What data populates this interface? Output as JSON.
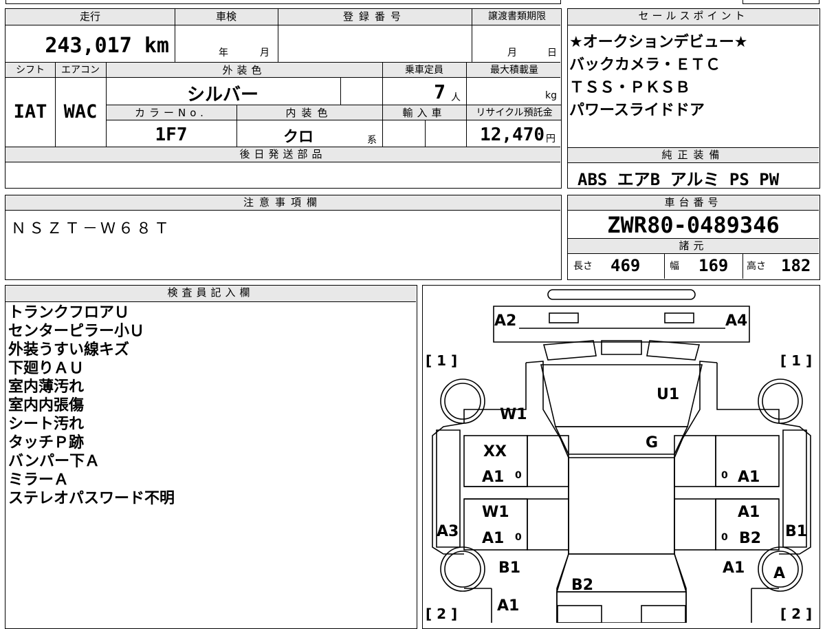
{
  "sheet": {
    "top_labels": {
      "mileage": "走行",
      "shaken": "車検",
      "reg_number": "登録番号",
      "transfer_deadline": "譲渡書類期限",
      "sales_points": "セールスポイント",
      "shift": "シフト",
      "aircon": "エアコン",
      "exterior_color": "外装色",
      "capacity": "乗車定員",
      "max_load": "最大積載量",
      "color_no": "カラーNo.",
      "interior_color": "内装色",
      "import": "輸入車",
      "recycle": "リサイクル預託金",
      "later_parts": "後日発送部品",
      "genuine_equipment": "純正装備",
      "notes": "注意事項欄",
      "chassis_number": "車台番号",
      "specs": "諸元",
      "inspector": "検査員記入欄"
    },
    "mileage_value": "243,017",
    "mileage_unit": "km",
    "shaken_year": "年",
    "shaken_month": "月",
    "transfer_month": "月",
    "transfer_day": "日",
    "shift_value": "IAT",
    "aircon_value": "WAC",
    "exterior_color_value": "シルバー",
    "capacity_value": "7",
    "capacity_unit": "人",
    "max_load_unit": "kg",
    "color_no_value": "1F7",
    "interior_color_value": "クロ",
    "interior_color_suffix": "系",
    "recycle_value": "12,470",
    "recycle_unit": "円",
    "sales_points_lines": [
      "★オークションデビュー★",
      "バックカメラ・ＥＴＣ",
      "ＴＳＳ・ＰＫＳＢ",
      "パワースライドドア"
    ],
    "genuine_equipment_value": "ABS エアB アルミ PS PW",
    "notes_value": "ＮＳＺＴ－Ｗ６８Ｔ",
    "chassis_number_value": "ZWR80-0489346",
    "spec_length_label": "長さ",
    "spec_length_value": "469",
    "spec_width_label": "幅",
    "spec_width_value": "169",
    "spec_height_label": "高さ",
    "spec_height_value": "182",
    "inspector_lines": [
      "トランクフロアＵ",
      "センターピラー小Ｕ",
      "外装うすい線キズ",
      "下廻りＡＵ",
      "室内薄汚れ",
      "室内内張傷",
      "シート汚れ",
      "タッチＰ跡",
      "バンパー下Ａ",
      "ミラーＡ",
      "ステレオパスワード不明"
    ]
  },
  "diagram": {
    "marks": {
      "a2": "A2",
      "a4": "A4",
      "u1": "U1",
      "w1_left": "W1",
      "g": "G",
      "xx": "XX",
      "a1_lf": "A1",
      "a1_rf": "A1",
      "w1_lr": "W1",
      "a1_rr_top": "A1",
      "a3": "A3",
      "a1_lr": "A1",
      "b2_rr": "B2",
      "b1_right": "B1",
      "b1_lrear": "B1",
      "a1_rrear": "A1",
      "a_wheel": "A",
      "b2_rear": "B2",
      "a1_bottom": "A1"
    },
    "brackets": {
      "tl": "[ 1 ]",
      "tr": "[ 1 ]",
      "bl": "[ 2 ]",
      "br": "[ 2 ]"
    },
    "small": {
      "s1": "0",
      "s2": "0",
      "s3": "0",
      "s4": "0"
    }
  }
}
